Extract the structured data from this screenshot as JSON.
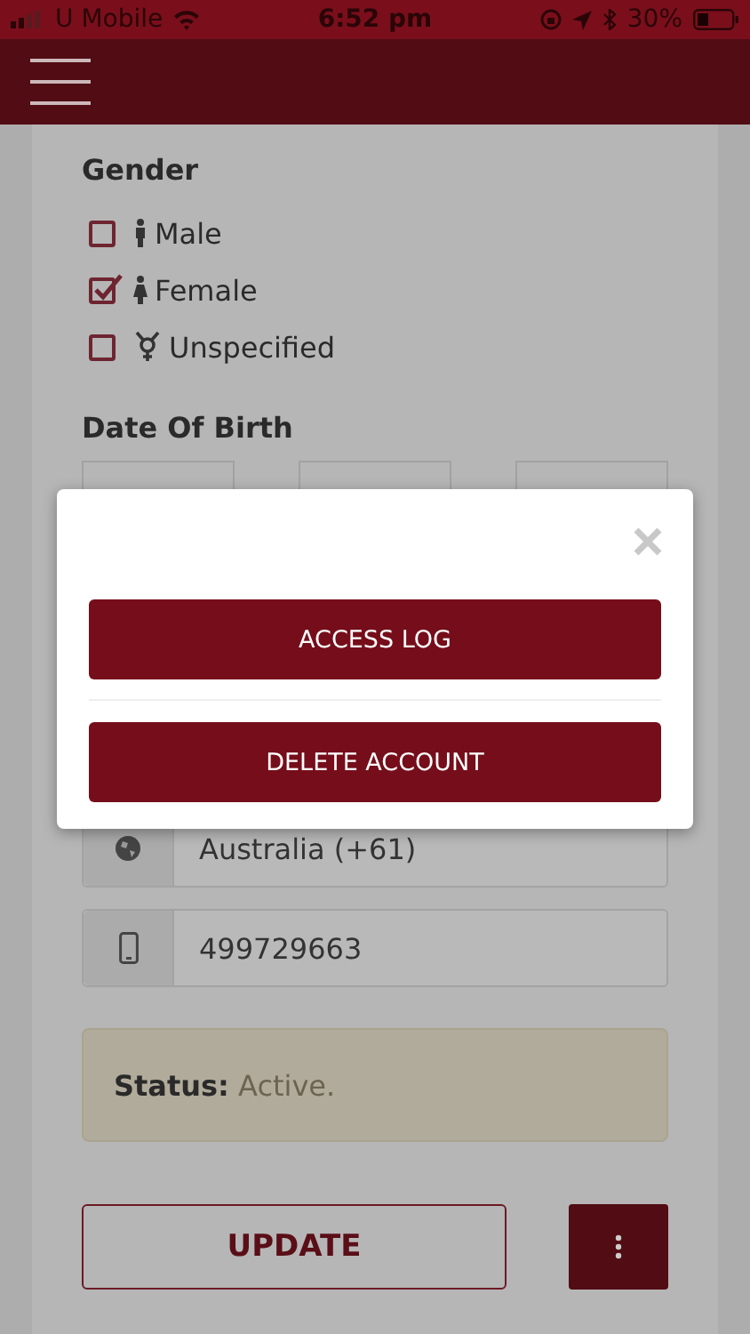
{
  "status_bar": {
    "carrier": "U Mobile",
    "time": "6:52 pm",
    "battery": "30%"
  },
  "gender": {
    "label": "Gender",
    "options": [
      {
        "label": "Male",
        "kind": "male",
        "checked": false
      },
      {
        "label": "Female",
        "kind": "female",
        "checked": true
      },
      {
        "label": "Unspecified",
        "kind": "unspecified",
        "checked": false
      }
    ]
  },
  "date_of_birth": {
    "label": "Date Of Birth"
  },
  "country_field": {
    "value": "Australia (+61)"
  },
  "phone_field": {
    "value": "499729663"
  },
  "status": {
    "label": "Status:",
    "value": "Active."
  },
  "update_button": "UPDATE",
  "modal": {
    "buttons": [
      "ACCESS LOG",
      "DELETE ACCOUNT"
    ]
  }
}
